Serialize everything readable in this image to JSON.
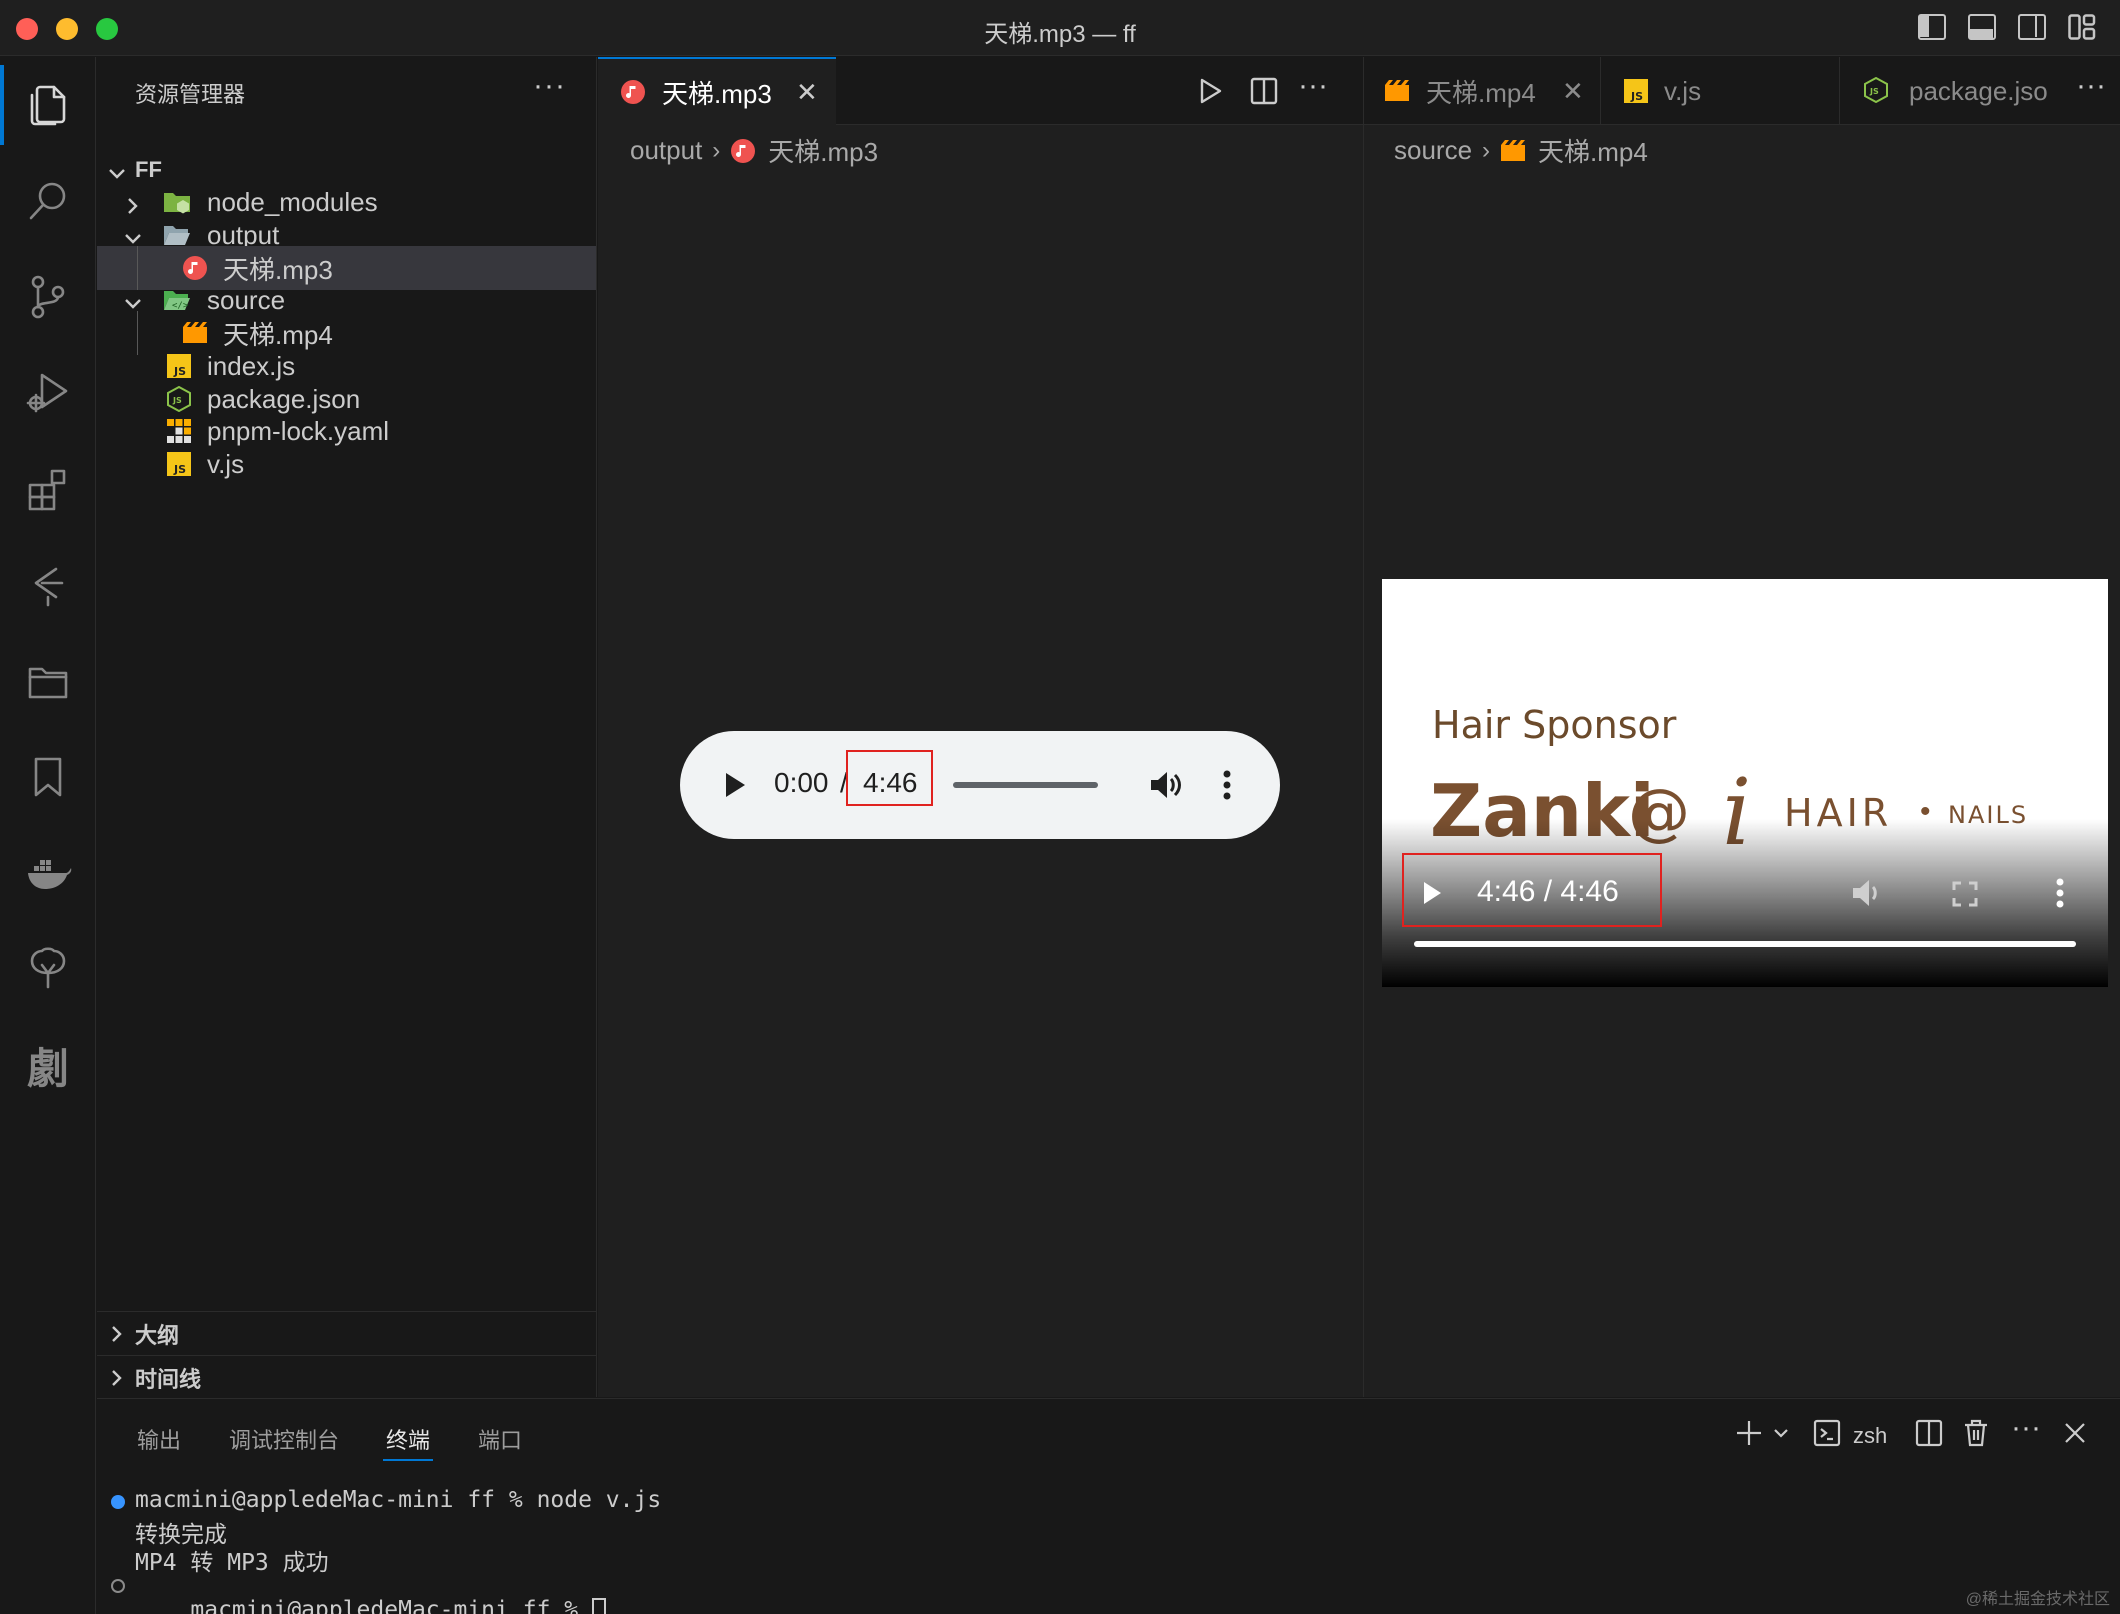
{
  "window": {
    "title": "天梯.mp3 — ff"
  },
  "colors": {
    "accent": "#0078d4",
    "close": "#ff5f57",
    "minimize": "#febc2e",
    "maximize": "#28c840",
    "highlight_box": "#e0221f",
    "video_brown": "#7a5030"
  },
  "activity_bar": {
    "items": [
      "files-icon",
      "search-icon",
      "source-control-icon",
      "run-debug-icon",
      "extensions-icon",
      "git-graph-icon",
      "folders-icon",
      "bookmark-icon",
      "docker-icon",
      "tree-icon",
      "chinese-char-icon"
    ]
  },
  "sidebar": {
    "header": "资源管理器",
    "more": "···",
    "root": "FF",
    "tree": [
      {
        "label": "node_modules",
        "icon": "folder-node-icon"
      },
      {
        "label": "output",
        "icon": "folder-open-icon"
      },
      {
        "label": "天梯.mp3",
        "icon": "audio-file-icon"
      },
      {
        "label": "source",
        "icon": "folder-src-icon"
      },
      {
        "label": "天梯.mp4",
        "icon": "video-file-icon"
      },
      {
        "label": "index.js",
        "icon": "js-file-icon"
      },
      {
        "label": "package.json",
        "icon": "nodejs-icon"
      },
      {
        "label": "pnpm-lock.yaml",
        "icon": "pnpm-icon"
      },
      {
        "label": "v.js",
        "icon": "js-file-icon"
      }
    ],
    "outline": "大纲",
    "timeline": "时间线"
  },
  "editor_left": {
    "tab": "天梯.mp3",
    "breadcrumb": [
      "output",
      "天梯.mp3"
    ],
    "audio": {
      "current": "0:00",
      "separator": "/",
      "duration": "4:46"
    }
  },
  "editor_right": {
    "tabs": [
      "天梯.mp4",
      "v.js",
      "package.jso"
    ],
    "breadcrumb": [
      "source",
      "天梯.mp4"
    ],
    "video": {
      "sponsor": "Hair Sponsor",
      "brand": "Zanki",
      "at": "@",
      "i": "i",
      "hair": "HAIR",
      "dot": "•",
      "nails": "NAILS",
      "time": "4:46 / 4:46",
      "progress": 1.0
    }
  },
  "panel": {
    "tabs": [
      "输出",
      "调试控制台",
      "终端",
      "端口"
    ],
    "shell": "zsh",
    "lines": [
      "macmini@appledeMac-mini ff % node v.js",
      "转换完成",
      "MP4 转 MP3 成功",
      "macmini@appledeMac-mini ff % "
    ]
  },
  "watermark": "@稀土掘金技术社区"
}
